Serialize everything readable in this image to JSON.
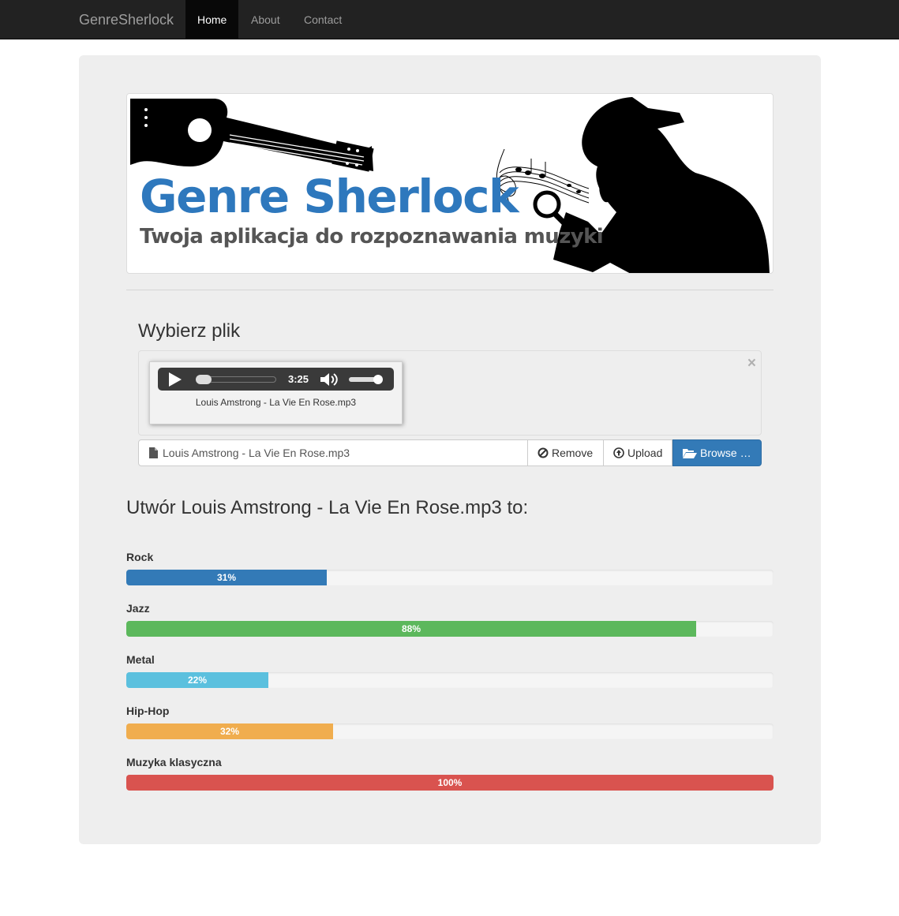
{
  "nav": {
    "brand": "GenreSherlock",
    "items": [
      {
        "label": "Home",
        "active": true
      },
      {
        "label": "About",
        "active": false
      },
      {
        "label": "Contact",
        "active": false
      }
    ]
  },
  "banner": {
    "title": "Genre Sherlock",
    "subtitle": "Twoja aplikacja do rozpoznawania muzyki"
  },
  "upload": {
    "heading": "Wybierz plik",
    "close_symbol": "×",
    "player": {
      "time": "3:25",
      "progress": 0.0,
      "volume": 0.85
    },
    "preview_caption": "Louis Amstrong - La Vie En Rose.mp3",
    "file_caption": "Louis Amstrong - La Vie En Rose.mp3",
    "remove_label": "Remove",
    "upload_label": "Upload",
    "browse_label": "Browse …"
  },
  "result": {
    "heading": "Utwór Louis Amstrong - La Vie En Rose.mp3 to:",
    "genres": [
      {
        "name": "Rock",
        "percent": 31,
        "label": "31%",
        "color": "#337ab7"
      },
      {
        "name": "Jazz",
        "percent": 88,
        "label": "88%",
        "color": "#5cb85c"
      },
      {
        "name": "Metal",
        "percent": 22,
        "label": "22%",
        "color": "#5bc0de"
      },
      {
        "name": "Hip-Hop",
        "percent": 32,
        "label": "32%",
        "color": "#f0ad4e"
      },
      {
        "name": "Muzyka klasyczna",
        "percent": 100,
        "label": "100%",
        "color": "#d9534f"
      }
    ]
  }
}
